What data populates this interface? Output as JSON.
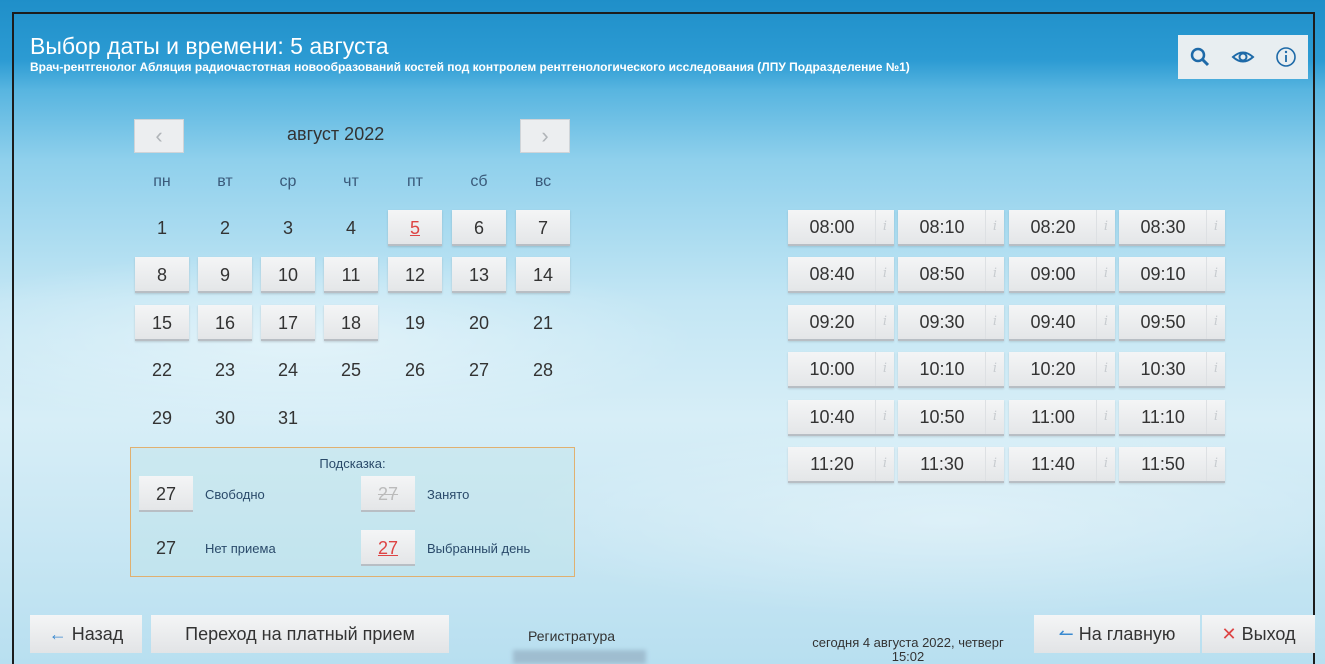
{
  "header": {
    "title": "Выбор даты и времени: 5 августа",
    "subtitle": "Врач-рентгенолог Абляция радиочастотная новообразований костей под контролем рентгенологического исследования (ЛПУ Подразделение №1)"
  },
  "toolbar": {
    "icons": [
      "search-icon",
      "eye-icon",
      "info-icon"
    ]
  },
  "calendar": {
    "month_label": "август 2022",
    "prev_label": "‹",
    "next_label": "›",
    "weekdays": [
      "пн",
      "вт",
      "ср",
      "чт",
      "пт",
      "сб",
      "вс"
    ],
    "days": [
      {
        "d": "1",
        "s": "none"
      },
      {
        "d": "2",
        "s": "none"
      },
      {
        "d": "3",
        "s": "none"
      },
      {
        "d": "4",
        "s": "none"
      },
      {
        "d": "5",
        "s": "selected"
      },
      {
        "d": "6",
        "s": "free"
      },
      {
        "d": "7",
        "s": "free"
      },
      {
        "d": "8",
        "s": "free"
      },
      {
        "d": "9",
        "s": "free"
      },
      {
        "d": "10",
        "s": "free"
      },
      {
        "d": "11",
        "s": "free"
      },
      {
        "d": "12",
        "s": "free"
      },
      {
        "d": "13",
        "s": "free"
      },
      {
        "d": "14",
        "s": "free"
      },
      {
        "d": "15",
        "s": "free"
      },
      {
        "d": "16",
        "s": "free"
      },
      {
        "d": "17",
        "s": "free"
      },
      {
        "d": "18",
        "s": "free"
      },
      {
        "d": "19",
        "s": "none"
      },
      {
        "d": "20",
        "s": "none"
      },
      {
        "d": "21",
        "s": "none"
      },
      {
        "d": "22",
        "s": "none"
      },
      {
        "d": "23",
        "s": "none"
      },
      {
        "d": "24",
        "s": "none"
      },
      {
        "d": "25",
        "s": "none"
      },
      {
        "d": "26",
        "s": "none"
      },
      {
        "d": "27",
        "s": "none"
      },
      {
        "d": "28",
        "s": "none"
      },
      {
        "d": "29",
        "s": "none"
      },
      {
        "d": "30",
        "s": "none"
      },
      {
        "d": "31",
        "s": "none"
      }
    ]
  },
  "legend": {
    "title": "Подсказка:",
    "sample_day": "27",
    "free": "Свободно",
    "busy": "Занято",
    "no_reception": "Нет приема",
    "selected": "Выбранный день"
  },
  "slots": {
    "info_glyph": "i",
    "times": [
      "08:00",
      "08:10",
      "08:20",
      "08:30",
      "08:40",
      "08:50",
      "09:00",
      "09:10",
      "09:20",
      "09:30",
      "09:40",
      "09:50",
      "10:00",
      "10:10",
      "10:20",
      "10:30",
      "10:40",
      "10:50",
      "11:00",
      "11:10",
      "11:20",
      "11:30",
      "11:40",
      "11:50"
    ]
  },
  "footer": {
    "back": "Назад",
    "paid": "Переход на платный прием",
    "registry": "Регистратура",
    "today_line1": "сегодня 4 августа 2022, четверг",
    "today_line2": "15:02",
    "home": "На главную",
    "exit": "Выход",
    "arrow_left": "←",
    "arrow_home": "↼",
    "cross": "✕"
  }
}
